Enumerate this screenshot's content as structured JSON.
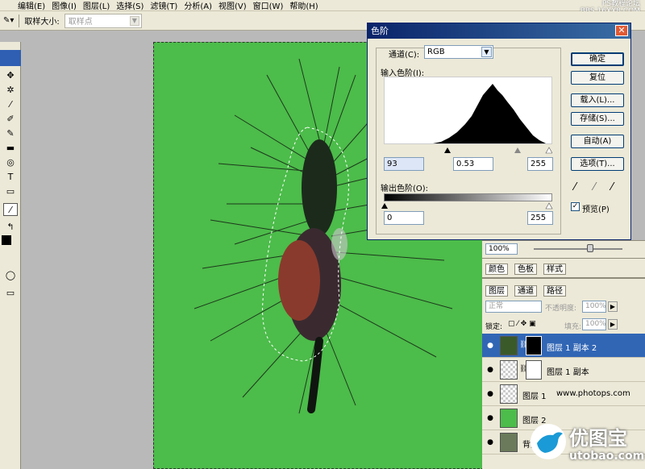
{
  "menu": [
    "编辑(E)",
    "图像(I)",
    "图层(L)",
    "选择(S)",
    "滤镜(T)",
    "分析(A)",
    "视图(V)",
    "窗口(W)",
    "帮助(H)"
  ],
  "watermark_top": [
    "PS教程论坛",
    "BBS.16XX8.COM"
  ],
  "options": {
    "sample_size_label": "取样大小:",
    "sample_size_value": "取样点"
  },
  "levels": {
    "title": "色阶",
    "channel_label": "通道(C):",
    "channel_value": "RGB",
    "input_label": "输入色阶(I):",
    "input_black": "93",
    "input_gamma": "0.53",
    "input_white": "255",
    "output_label": "输出色阶(O):",
    "output_black": "0",
    "output_white": "255",
    "buttons": {
      "ok": "确定",
      "reset": "复位",
      "load": "载入(L)...",
      "save": "存储(S)...",
      "auto": "自动(A)",
      "options": "选项(T)..."
    },
    "preview_label": "预览(P)"
  },
  "navigator": {
    "zoom": "100%"
  },
  "color_tabs": [
    "颜色",
    "色板",
    "样式"
  ],
  "layers": {
    "tabs": [
      "图层",
      "通道",
      "路径"
    ],
    "blend_mode": "正常",
    "opacity_label": "不透明度:",
    "opacity_value": "100%",
    "lock_label": "锁定:",
    "fill_label": "填充:",
    "fill_value": "100%",
    "rows": [
      {
        "name": "图层 1 副本 2"
      },
      {
        "name": "图层 1 副本"
      },
      {
        "name": "图层 1"
      },
      {
        "name": "图层 2"
      },
      {
        "name": "背景"
      }
    ],
    "row_watermark": "www.photops.com"
  },
  "brand": {
    "name": "优图宝",
    "url": "utobao.com"
  },
  "colors": {
    "canvas_green": "#4cbc4a",
    "selected_row": "#3166b5",
    "titlebar": "#0a246a"
  }
}
